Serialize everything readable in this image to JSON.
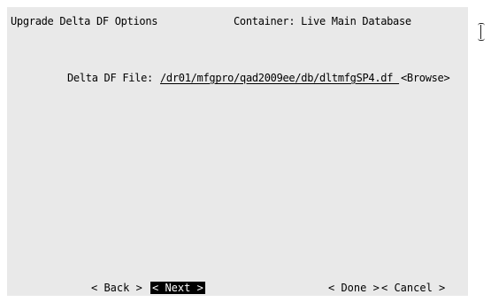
{
  "header": {
    "title": "Upgrade Delta DF Options",
    "container": "Container: Live Main Database"
  },
  "form": {
    "delta_df_label": "Delta DF File:",
    "delta_df_value": "/dr01/mfgpro/qad2009ee/db/dltmfgSP4.df ",
    "browse_label": "<Browse>"
  },
  "buttons": {
    "back": "< Back >",
    "next": "< Next >",
    "done": "< Done >",
    "cancel": "< Cancel >"
  },
  "cursor": {
    "icon": "text-cursor-icon"
  }
}
